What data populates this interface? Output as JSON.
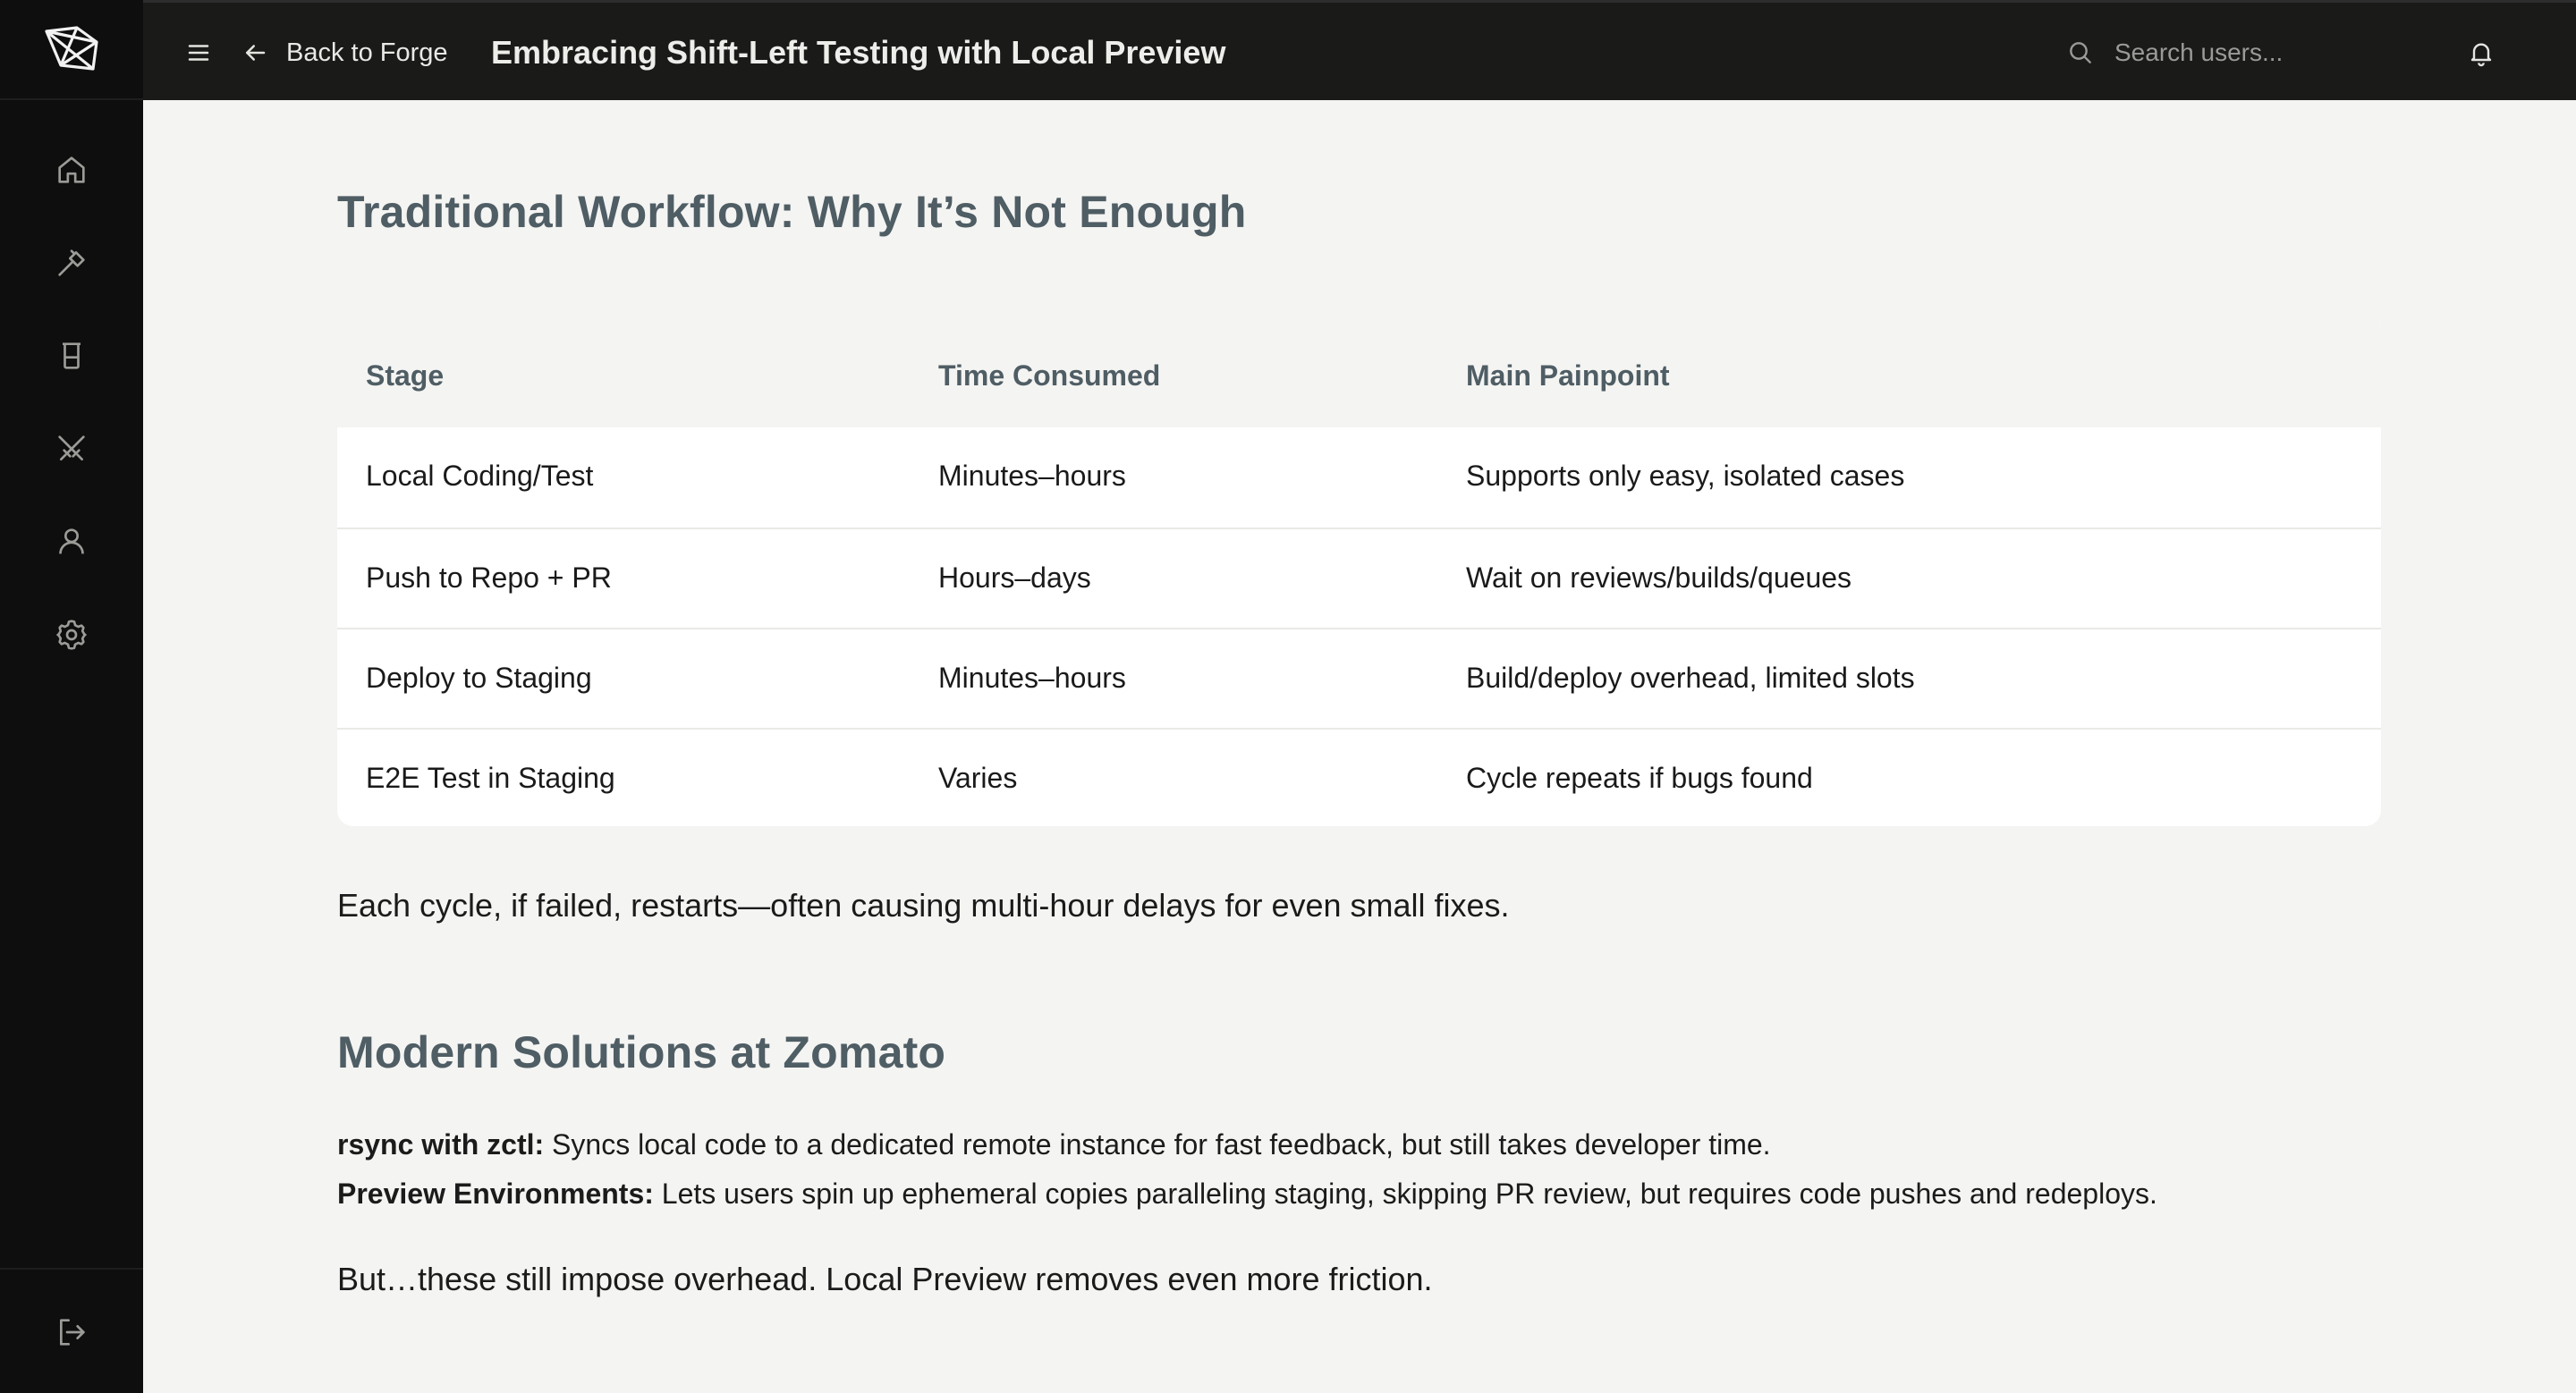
{
  "nav": {
    "back_label": "Back to Forge",
    "page_title": "Embracing Shift-Left Testing with Local Preview",
    "search_placeholder": "Search users...",
    "icons": {
      "logo": "forge-logo-icon",
      "menu": "menu-icon",
      "back": "arrow-left-icon",
      "search": "search-icon",
      "bell": "bell-icon"
    }
  },
  "sidebar": {
    "items": [
      {
        "name": "home",
        "icon": "home-icon"
      },
      {
        "name": "build",
        "icon": "hammer-icon"
      },
      {
        "name": "tests",
        "icon": "beaker-icon"
      },
      {
        "name": "tools",
        "icon": "crossed-swords-icon"
      },
      {
        "name": "profile",
        "icon": "user-icon"
      },
      {
        "name": "settings",
        "icon": "gear-icon"
      }
    ],
    "logout_icon": "logout-icon"
  },
  "article": {
    "workflow_heading": "Traditional Workflow: Why It’s Not Enough",
    "table": {
      "headers": [
        "Stage",
        "Time Consumed",
        "Main Painpoint"
      ],
      "rows": [
        [
          "Local Coding/Test",
          "Minutes–hours",
          "Supports only easy, isolated cases"
        ],
        [
          "Push to Repo + PR",
          "Hours–days",
          "Wait on reviews/builds/queues"
        ],
        [
          "Deploy to Staging",
          "Minutes–hours",
          "Build/deploy overhead, limited slots"
        ],
        [
          "E2E Test in Staging",
          "Varies",
          "Cycle repeats if bugs found"
        ]
      ]
    },
    "cycle_note": "Each cycle, if failed, restarts—often causing multi-hour delays for even small fixes.",
    "modern_heading": "Modern Solutions at Zomato",
    "rsync_label": "rsync with zctl:",
    "rsync_text": " Syncs local code to a dedicated remote instance for fast feedback, but still takes developer time.",
    "preview_label": "Preview Environments:",
    "preview_text": " Lets users spin up ephemeral copies paralleling staging, skipping PR review, but requires code pushes and redeploys.",
    "closing": "But…these still impose overhead. Local Preview removes even more friction."
  },
  "colors": {
    "rail_bg": "#0e0e0e",
    "topbar_bg": "#1a1a19",
    "page_bg": "#f4f4f2",
    "heading": "#4f5d64",
    "icon": "#9b9b98"
  }
}
